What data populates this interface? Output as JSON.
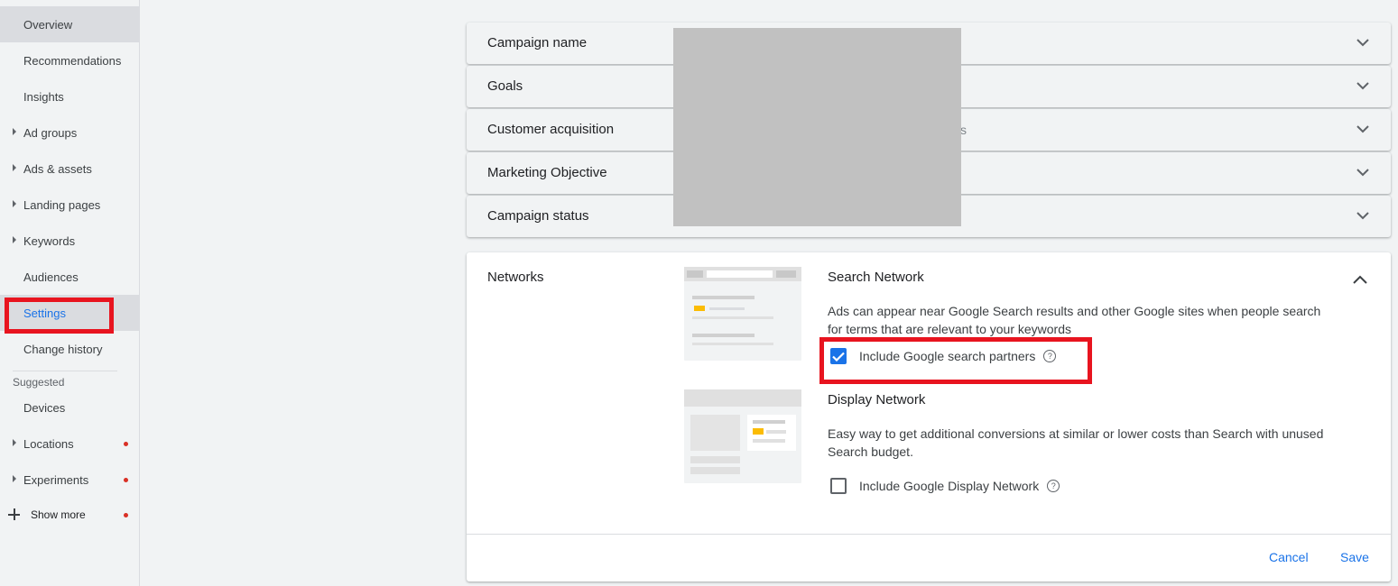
{
  "sidebar": {
    "items": [
      {
        "label": "Overview"
      },
      {
        "label": "Recommendations"
      },
      {
        "label": "Insights"
      },
      {
        "label": "Ad groups"
      },
      {
        "label": "Ads & assets"
      },
      {
        "label": "Landing pages"
      },
      {
        "label": "Keywords"
      },
      {
        "label": "Audiences"
      },
      {
        "label": "Settings"
      },
      {
        "label": "Change history"
      }
    ],
    "section_label": "Suggested",
    "suggested": [
      {
        "label": "Devices"
      },
      {
        "label": "Locations"
      },
      {
        "label": "Experiments"
      }
    ],
    "show_more": "Show more"
  },
  "rows": {
    "campaign_name": "Campaign name",
    "goals": "Goals",
    "customer_acquisition": "Customer acquisition",
    "customer_acquisition_value_fragment": "s",
    "marketing_objective": "Marketing Objective",
    "campaign_status": "Campaign status"
  },
  "networks": {
    "title": "Networks",
    "search": {
      "heading": "Search Network",
      "description": "Ads can appear near Google Search results and other Google sites when people search for terms that are relevant to your keywords",
      "checkbox_label": "Include Google search partners",
      "checked": true
    },
    "display": {
      "heading": "Display Network",
      "description": "Easy way to get additional conversions at similar or lower costs than Search with unused Search budget.",
      "checkbox_label": "Include Google Display Network",
      "checked": false
    },
    "cancel": "Cancel",
    "save": "Save"
  },
  "colors": {
    "accent": "#1a73e8",
    "highlight": "#e8141f",
    "notification_dot": "#d93025"
  }
}
